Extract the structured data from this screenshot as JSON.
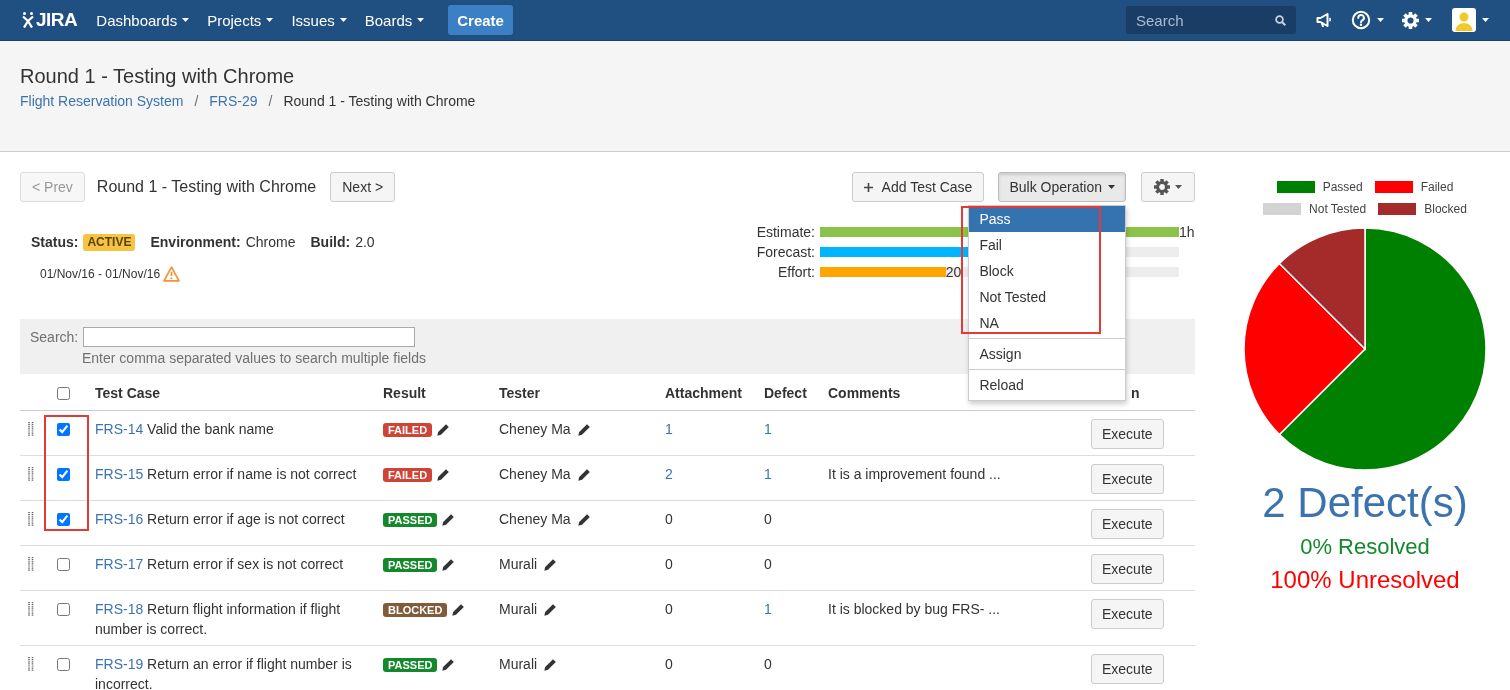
{
  "nav": {
    "logo": "JIRA",
    "menus": [
      {
        "label": "Dashboards"
      },
      {
        "label": "Projects"
      },
      {
        "label": "Issues"
      },
      {
        "label": "Boards"
      }
    ],
    "create": "Create",
    "search": {
      "placeholder": "Search"
    }
  },
  "header": {
    "title": "Round 1 - Testing with Chrome",
    "breadcrumbs": [
      {
        "kind": "link",
        "label": "Flight Reservation System"
      },
      {
        "kind": "separator",
        "label": "/"
      },
      {
        "kind": "link",
        "label": "FRS-29"
      },
      {
        "kind": "separator",
        "label": "/"
      },
      {
        "kind": "current",
        "label": "Round 1 - Testing with Chrome"
      }
    ]
  },
  "toolbar": {
    "prev": {
      "label": "< Prev",
      "disabled": true
    },
    "title": "Round 1 - Testing with Chrome",
    "next": {
      "label": "Next >",
      "disabled": false
    },
    "add": {
      "label": "Add Test Case"
    },
    "bulk": {
      "label": "Bulk Operation",
      "expanded": true
    }
  },
  "bulk_menu": {
    "groups": [
      {
        "outlined": true,
        "items": [
          {
            "label": "Pass",
            "selected": true
          },
          {
            "label": "Fail",
            "selected": false
          },
          {
            "label": "Block",
            "selected": false
          },
          {
            "label": "Not Tested",
            "selected": false
          },
          {
            "label": "NA",
            "selected": false
          }
        ]
      },
      {
        "outlined": false,
        "items": [
          {
            "label": "Assign",
            "selected": false
          }
        ]
      },
      {
        "outlined": false,
        "items": [
          {
            "label": "Reload",
            "selected": false
          }
        ]
      }
    ]
  },
  "cycle": {
    "status_label": "Status:",
    "status": "ACTIVE",
    "environment_label": "Environment:",
    "environment": "Chrome",
    "build_label": "Build:",
    "build": "2.0",
    "dates": "01/Nov/16 - 01/Nov/16",
    "warning": true
  },
  "progress": [
    {
      "label": "Estimate:",
      "level": 1,
      "reading": "1h",
      "color": "#8bc34a"
    },
    {
      "label": "Forecast:",
      "level": 0.42,
      "color": "#00b4ff"
    },
    {
      "label": "Effort:",
      "level": 0.35,
      "reading": "20",
      "color": "#ffa500"
    }
  ],
  "search": {
    "label": "Search:",
    "hint": "Enter comma separated values to search multiple fields"
  },
  "table": {
    "select_all": {
      "checked": false
    },
    "checkbox_outline": true,
    "columns": [
      {
        "label": "Test Case"
      },
      {
        "label": "Result"
      },
      {
        "label": "Tester"
      },
      {
        "label": "Attachment"
      },
      {
        "label": "Defect"
      },
      {
        "label": "Comments"
      },
      {
        "label": "n"
      }
    ],
    "rows": [
      {
        "checked": true,
        "key": "FRS-14",
        "summary": "Valid the bank name",
        "result": {
          "text": "FAILED",
          "color": "#d04437"
        },
        "tester": "Cheney Ma",
        "attachment": {
          "text": "1",
          "link": true
        },
        "defect": {
          "text": "1",
          "link": true
        },
        "action": "Execute"
      },
      {
        "checked": true,
        "key": "FRS-15",
        "summary": "Return error if name is not correct",
        "result": {
          "text": "FAILED",
          "color": "#d04437"
        },
        "tester": "Cheney Ma",
        "attachment": {
          "text": "2",
          "link": true
        },
        "defect": {
          "text": "1",
          "link": true
        },
        "comment": "It is a improvement found ...",
        "action": "Execute"
      },
      {
        "checked": true,
        "key": "FRS-16",
        "summary": "Return error if age is not correct",
        "result": {
          "text": "PASSED",
          "color": "#14892c"
        },
        "tester": "Cheney Ma",
        "attachment": {
          "text": "0",
          "link": false
        },
        "defect": {
          "text": "0",
          "link": false
        },
        "action": "Execute"
      },
      {
        "checked": false,
        "key": "FRS-17",
        "summary": "Return error if sex is not correct",
        "result": {
          "text": "PASSED",
          "color": "#14892c"
        },
        "tester": "Murali",
        "attachment": {
          "text": "0",
          "link": false
        },
        "defect": {
          "text": "0",
          "link": false
        },
        "action": "Execute"
      },
      {
        "checked": false,
        "key": "FRS-18",
        "summary": "Return flight information if flight number is correct.",
        "result": {
          "text": "BLOCKED",
          "color": "#815b3a"
        },
        "tester": "Murali",
        "attachment": {
          "text": "0",
          "link": false
        },
        "defect": {
          "text": "1",
          "link": true
        },
        "comment": "It is blocked by bug FRS- ...",
        "action": "Execute"
      },
      {
        "checked": false,
        "key": "FRS-19",
        "summary": "Return an error if flight number is incorrect.",
        "result": {
          "text": "PASSED",
          "color": "#14892c"
        },
        "tester": "Murali",
        "attachment": {
          "text": "0",
          "link": false
        },
        "defect": {
          "text": "0",
          "link": false
        },
        "action": "Execute"
      }
    ]
  },
  "summary": {
    "legend": [
      {
        "label": "Passed",
        "color": "#008000"
      },
      {
        "label": "Failed",
        "color": "#ff0000"
      },
      {
        "label": "Not Tested",
        "color": "#d3d3d3"
      },
      {
        "label": "Blocked",
        "color": "#a52a2a"
      }
    ],
    "defects": "2 Defect(s)",
    "resolved": "0% Resolved",
    "unresolved": "100% Unresolved"
  }
}
